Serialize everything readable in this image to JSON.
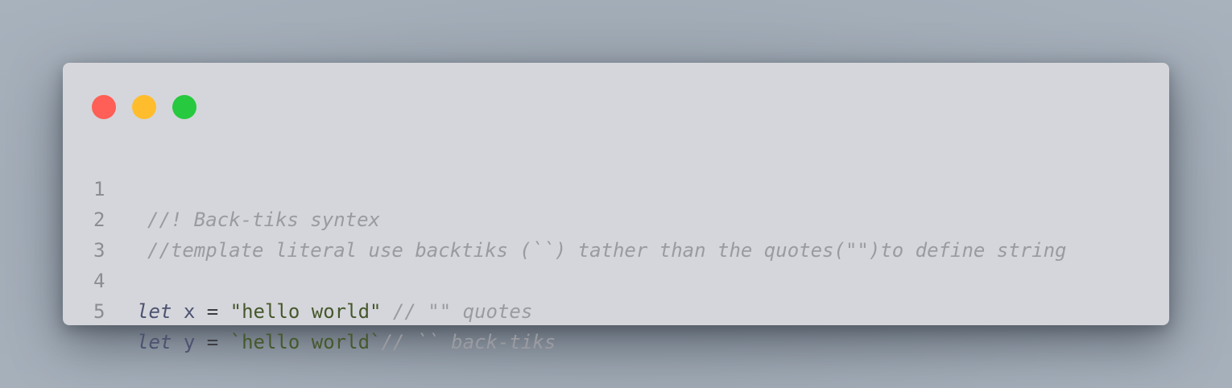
{
  "colors": {
    "close": "#ff5f56",
    "minimize": "#ffbd2e",
    "maximize": "#27c93f"
  },
  "editor": {
    "lines": [
      {
        "number": "1",
        "comment": "//! Back-tiks syntex"
      },
      {
        "number": "2",
        "comment": "//template literal use backtiks (``) tather than the quotes(\"\")to define string"
      },
      {
        "number": "3"
      },
      {
        "number": "4",
        "keyword": "let",
        "identifier": "x",
        "operator": "=",
        "string": "\"hello world\"",
        "comment": " // \"\" quotes"
      },
      {
        "number": "5",
        "keyword": "let",
        "identifier": "y",
        "operator": "=",
        "string": "`hello world`",
        "comment": "// `` back-tiks"
      }
    ]
  }
}
